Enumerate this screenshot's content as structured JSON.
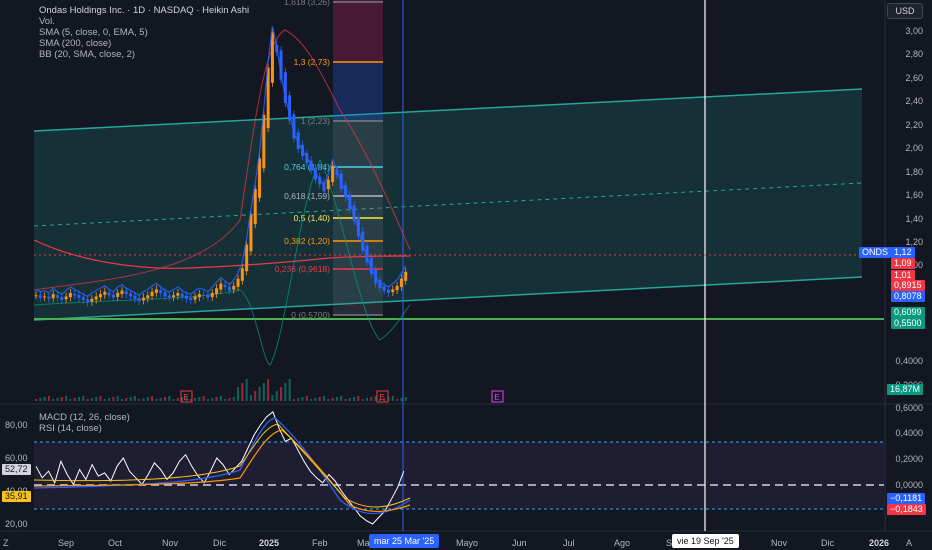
{
  "header": {
    "title": "Ondas Holdings Inc. · 1D · NASDAQ · Heikin Ashi",
    "indicators": [
      "Vol.",
      "SMA (5, close, 0, EMA, 5)",
      "SMA (200, close)",
      "BB (20, SMA, close, 2)"
    ],
    "currency_button": "USD"
  },
  "lower_pane": {
    "indicators": [
      "MACD (12, 26, close)",
      "RSI (14, close)"
    ],
    "left_axis_labels": [
      "80,00",
      "60,00",
      "40,00",
      "20,00"
    ],
    "rsi_value_tag": "52,72",
    "rsi_ma_tag": "35,91",
    "right_axis_labels": [
      "0,6000",
      "0,4000",
      "0,2000",
      "0,0000"
    ],
    "macd_tags": [
      "−0,1181",
      "−0,1843"
    ]
  },
  "price_axis": {
    "labels": [
      "3,00",
      "2,80",
      "2,60",
      "2,40",
      "2,20",
      "2,00",
      "1,80",
      "1,60",
      "1,40",
      "1,20",
      "1,00",
      "0,4000",
      "0,2000",
      "0,0000"
    ],
    "partial_label": "1,00",
    "tags": [
      {
        "text": "ONDS",
        "color": "#2962ff"
      },
      {
        "text": "1,12",
        "color": "#2962ff"
      },
      {
        "text": "1,09",
        "color": "#f23645"
      },
      {
        "text": "1,01",
        "color": "#f23645"
      },
      {
        "text": "0,8915",
        "color": "#f23645"
      },
      {
        "text": "0,8078",
        "color": "#2962ff"
      },
      {
        "text": "0,6099",
        "color": "#089981"
      },
      {
        "text": "0,5500",
        "color": "#089981"
      },
      {
        "text": "16,87M",
        "color": "#089981"
      }
    ]
  },
  "fib_levels": [
    "1,618 (3,26)",
    "1,3 (2,73)",
    "1 (2,23)",
    "0,764 (1,84)",
    "0,618 (1,59)",
    "0,5 (1,40)",
    "0,382 (1,20)",
    "0,236 (0,9618)",
    "0 (0,5700)"
  ],
  "time_axis": {
    "labels": [
      "Sep",
      "Oct",
      "Nov",
      "Dic",
      "2025",
      "Feb",
      "Ma",
      "Mayo",
      "Jun",
      "Jul",
      "Ago",
      "S",
      "Nov",
      "Dic",
      "2026"
    ],
    "crosshair_date": "mar 25 Mar '25",
    "cursor_date": "vie 19 Sep '25"
  },
  "event_markers": [
    "E",
    "E",
    "E"
  ],
  "colors": {
    "background": "#131722",
    "channel": "#26a69a",
    "crosshair": "#2962ff",
    "up": "#f7931a",
    "down": "#2962ff",
    "sma200": "#f23645",
    "rsi": "#ffffff",
    "macd": "#2962ff",
    "signal": "#ff9800"
  }
}
